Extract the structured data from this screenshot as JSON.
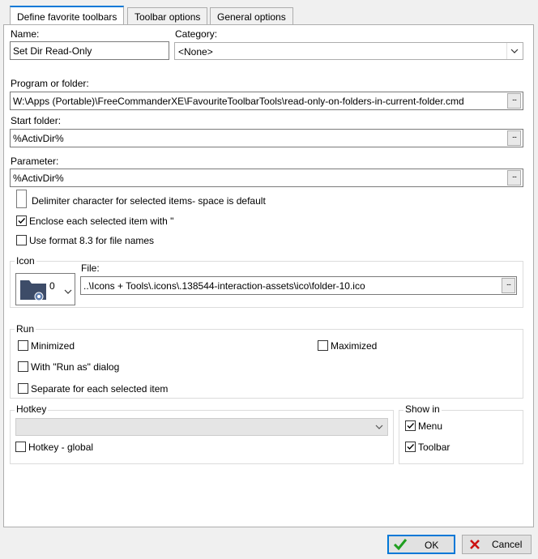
{
  "tabs": [
    {
      "label": "Define favorite toolbars",
      "active": true
    },
    {
      "label": "Toolbar options",
      "active": false
    },
    {
      "label": "General options",
      "active": false
    }
  ],
  "name": {
    "label": "Name:",
    "value": "Set Dir Read-Only"
  },
  "category": {
    "label": "Category:",
    "value": "<None>"
  },
  "program": {
    "label": "Program or folder:",
    "value": "W:\\Apps (Portable)\\FreeCommanderXE\\FavouriteToolbarTools\\read-only-on-folders-in-current-folder.cmd",
    "browse": "..."
  },
  "start_folder": {
    "label": "Start folder:",
    "value": "%ActivDir%",
    "browse": "..."
  },
  "parameter": {
    "label": "Parameter:",
    "value": "%ActivDir%",
    "browse": "..."
  },
  "delimiter": {
    "label": "Delimiter character for selected items- space is default",
    "value": ""
  },
  "checks": {
    "enclose": {
      "label": "Enclose each selected item with \"",
      "checked": true
    },
    "format83": {
      "label": "Use format 8.3 for file names",
      "checked": false
    }
  },
  "icon": {
    "group_label": "Icon",
    "index": "0",
    "file_label": "File:",
    "file_value": "..\\Icons + Tools\\.icons\\.138544-interaction-assets\\ico\\folder-10.ico",
    "browse": "...",
    "icon_name": "folder-icon"
  },
  "run": {
    "group_label": "Run",
    "minimized": {
      "label": "Minimized",
      "checked": false
    },
    "maximized": {
      "label": "Maximized",
      "checked": false
    },
    "run_as": {
      "label": "With \"Run as\" dialog",
      "checked": false
    },
    "separate": {
      "label": "Separate for each selected item",
      "checked": false
    }
  },
  "hotkey": {
    "group_label": "Hotkey",
    "value": "",
    "global": {
      "label": "Hotkey - global",
      "checked": false
    }
  },
  "show_in": {
    "group_label": "Show in",
    "menu": {
      "label": "Menu",
      "checked": true
    },
    "toolbar": {
      "label": "Toolbar",
      "checked": true
    }
  },
  "buttons": {
    "ok": {
      "label": "OK"
    },
    "cancel": {
      "label": "Cancel"
    }
  },
  "colors": {
    "accent": "#0078d7",
    "ok_check": "#1f9e1f",
    "cancel_x": "#cc1111"
  }
}
